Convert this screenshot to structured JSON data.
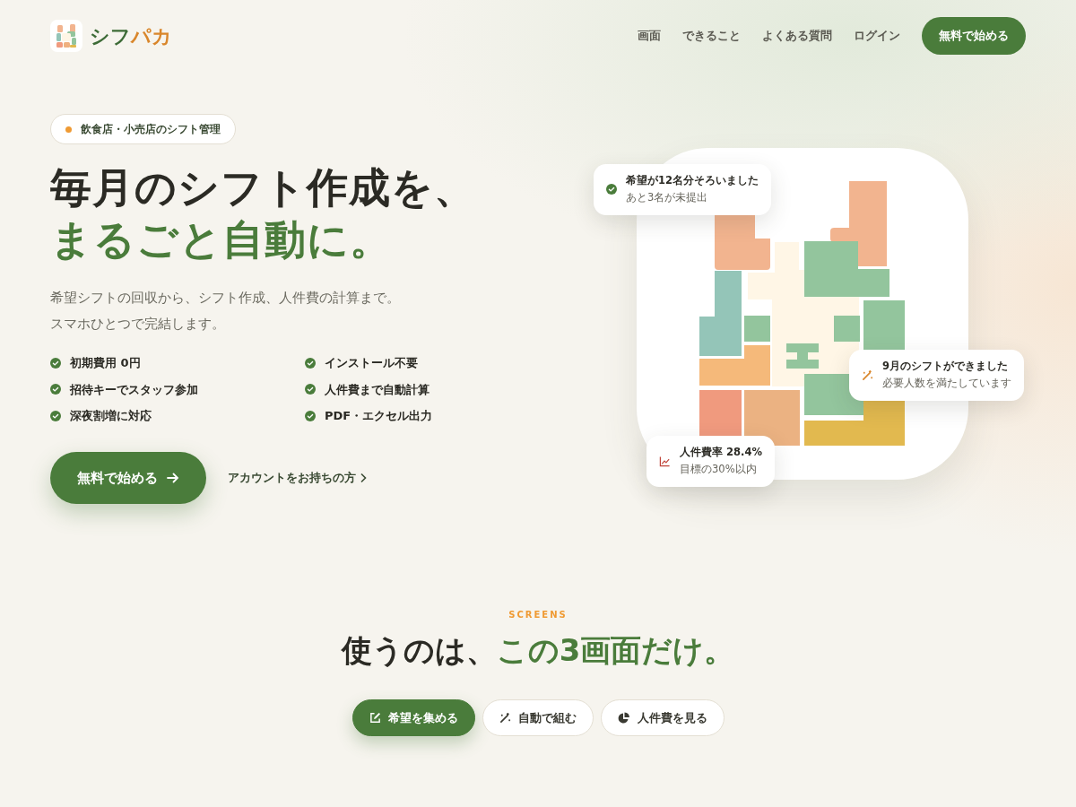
{
  "brand": {
    "name_main": "シフ",
    "name_accent": "パカ"
  },
  "nav": {
    "links": [
      "画面",
      "できること",
      "よくある質問",
      "ログイン"
    ],
    "cta": "無料で始める"
  },
  "hero": {
    "badge": "飲食店・小売店のシフト管理",
    "title_line1": "毎月のシフト作成を、",
    "title_line2": "まるごと自動に。",
    "lead": [
      "希望シフトの回収から、シフト作成、人件費の計算まで。",
      "スマホひとつで完結します。"
    ],
    "features": [
      "初期費用 0円",
      "インストール不要",
      "招待キーでスタッフ参加",
      "人件費まで自動計算",
      "深夜割増に対応",
      "PDF・エクセル出力"
    ],
    "primary_button": "無料で始める",
    "secondary_link": "アカウントをお持ちの方"
  },
  "notifications": [
    {
      "kind": "check",
      "title": "希望が12名分そろいました",
      "subtitle": "あと3名が未提出"
    },
    {
      "kind": "magic",
      "title": "9月のシフトができました",
      "subtitle": "必要人数を満たしています"
    },
    {
      "kind": "chart",
      "title": "人件費率 28.4%",
      "subtitle": "目標の30%以内"
    }
  ],
  "screens": {
    "eyebrow": "SCREENS",
    "title_plain": "使うのは、",
    "title_accent": "この3画面だけ。",
    "tabs": [
      {
        "kind": "edit",
        "label": "希望を集める",
        "selected": true
      },
      {
        "kind": "magic",
        "label": "自動で組む",
        "selected": false
      },
      {
        "kind": "pie",
        "label": "人件費を見る",
        "selected": false
      }
    ]
  }
}
